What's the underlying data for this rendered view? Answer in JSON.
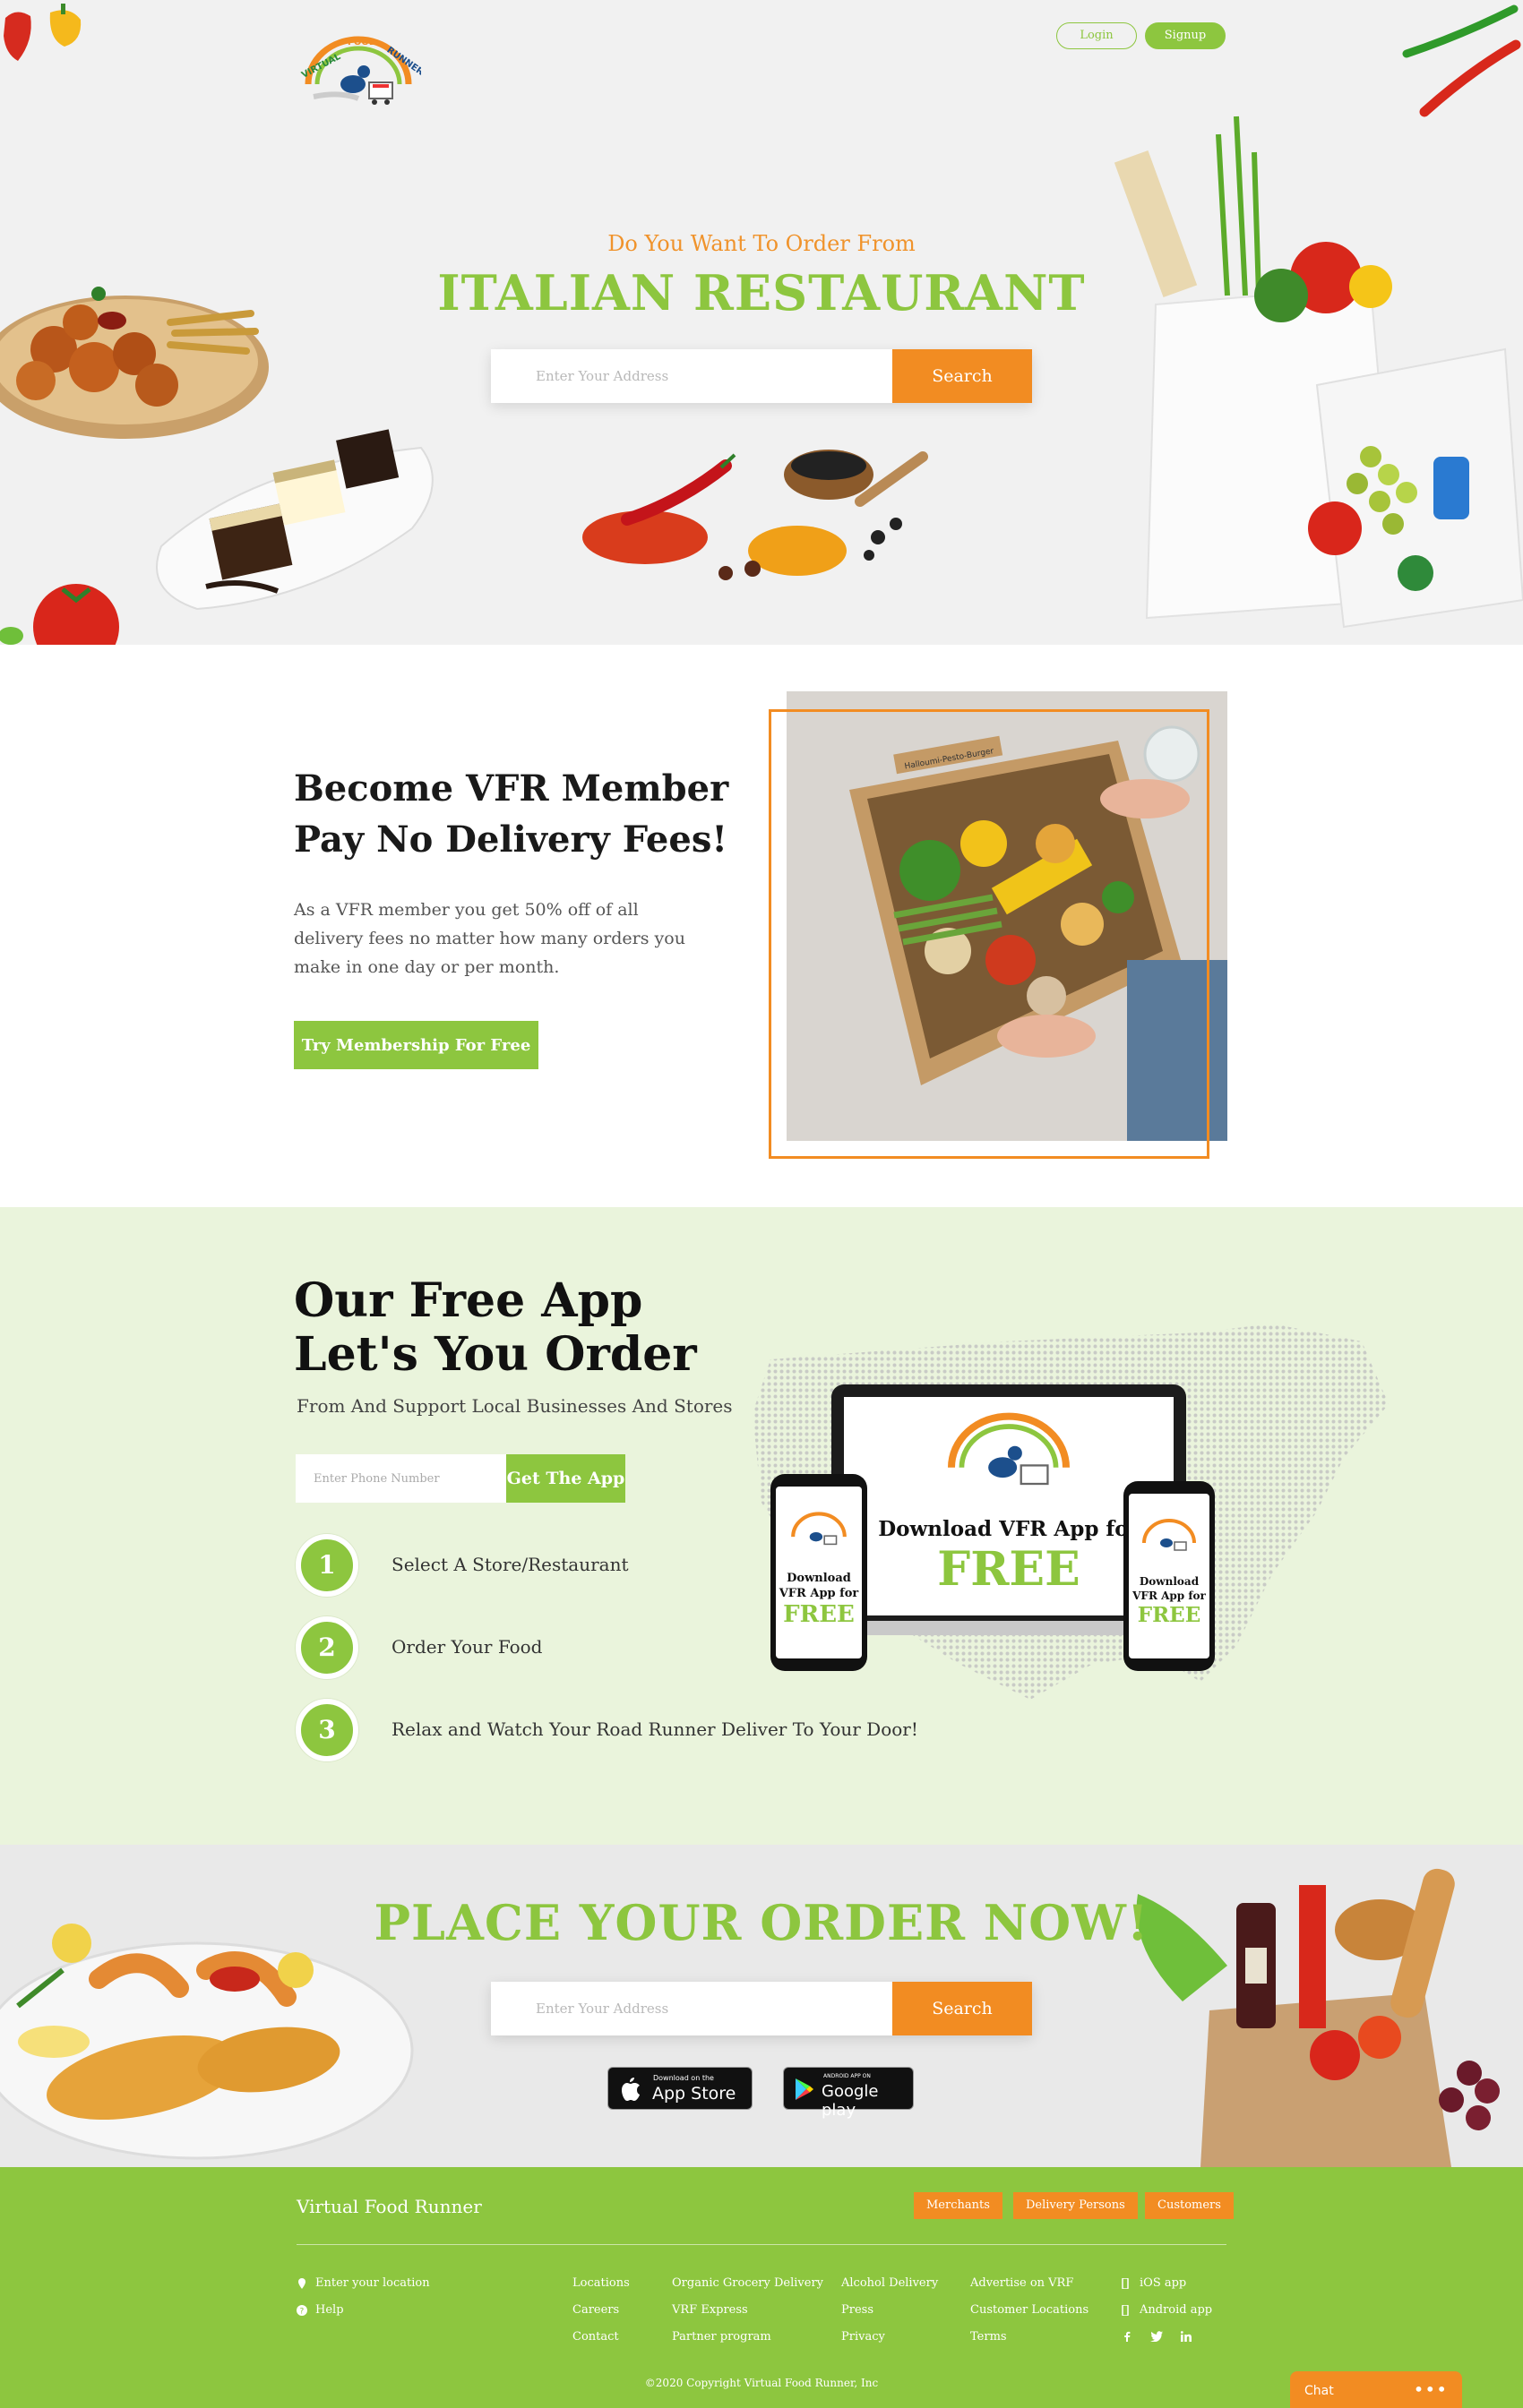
{
  "header": {
    "logo_text": "VIRTUAL FOOD RUNNER",
    "login_label": "Login",
    "signup_label": "Signup"
  },
  "hero": {
    "subtitle": "Do You Want To Order From",
    "title": "ITALIAN RESTAURANT",
    "search_placeholder": "Enter Your Address",
    "search_button": "Search"
  },
  "member": {
    "title_line1": "Become VFR Member",
    "title_line2": "Pay No Delivery Fees!",
    "text": "As a VFR member you get 50% off of all delivery fees no matter how many orders you make in one day or per month.",
    "button": "Try Membership For Free",
    "box_label": "Halloumi-Pesto-Burger"
  },
  "app": {
    "title_line1": "Our Free App",
    "title_line2": "Let's You Order",
    "subtitle": "From And Support Local Businesses And Stores",
    "phone_placeholder": "Enter Phone Number",
    "button": "Get The App",
    "steps": [
      {
        "number": "1",
        "text": "Select A Store/Restaurant"
      },
      {
        "number": "2",
        "text": "Order Your Food"
      },
      {
        "number": "3",
        "text": "Relax and Watch Your Road Runner Deliver To Your Door!"
      }
    ],
    "laptop_line1": "Download VFR App for",
    "laptop_line2": "FREE",
    "phone_line1": "Download",
    "phone_line2": "VFR App for",
    "phone_line3": "FREE"
  },
  "order": {
    "title": "PLACE YOUR ORDER NOW!",
    "search_placeholder": "Enter Your Address",
    "search_button": "Search",
    "appstore_small": "Download on the",
    "appstore_big": "App Store",
    "googleplay_small": "ANDROID APP ON",
    "googleplay_big": "Google play"
  },
  "footer": {
    "brand": "Virtual Food Runner",
    "tags": [
      "Merchants",
      "Delivery Persons",
      "Customers"
    ],
    "col_location": [
      "Enter your location",
      "Help"
    ],
    "col1": [
      "Locations",
      "Careers",
      "Contact"
    ],
    "col2": [
      "Organic Grocery Delivery",
      "VRF Express",
      "Partner program"
    ],
    "col3": [
      "Alcohol Delivery",
      "Press",
      "Privacy"
    ],
    "col4": [
      "Advertise on VRF",
      "Customer Locations",
      "Terms"
    ],
    "col5": [
      "iOS app",
      "Android app"
    ],
    "social": [
      "facebook-icon",
      "twitter-icon",
      "linkedin-icon"
    ],
    "copyright": "©2020 Copyright Virtual Food Runner, Inc"
  },
  "chat": {
    "label": "Chat",
    "dots": "•••"
  },
  "colors": {
    "green": "#8dc63f",
    "orange": "#f28c22",
    "hero_bg": "#f1f1f1",
    "app_bg": "#eaf4dc"
  }
}
